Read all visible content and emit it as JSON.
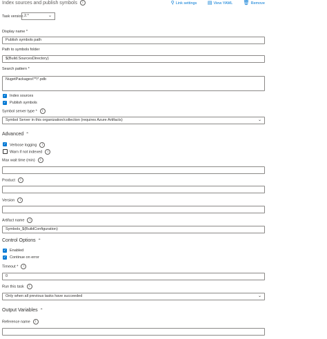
{
  "header": {
    "title": "Index sources and publish symbols",
    "link_settings": "Link settings",
    "view_yaml": "View YAML",
    "remove": "Remove"
  },
  "task_version": {
    "label": "Task version",
    "value": "2.*"
  },
  "fields": {
    "display_name": {
      "label": "Display name *",
      "value": "Publish symbols path"
    },
    "symbols_folder": {
      "label": "Path to symbols folder",
      "value": "$(Build.SourcesDirectory)"
    },
    "search_pattern": {
      "label": "Search pattern *",
      "value": "NugetPackages\\**\\*.pdb"
    },
    "symbol_server_type": {
      "label": "Symbol server type *",
      "value": "Symbol Server in this organization/collection (requires Azure Artifacts)"
    },
    "max_wait": {
      "label": "Max wait time (min)",
      "value": ""
    },
    "product": {
      "label": "Product",
      "value": ""
    },
    "version": {
      "label": "Version",
      "value": ""
    },
    "artifact_name": {
      "label": "Artifact name",
      "value": "Symbols_$(BuildConfiguration)"
    },
    "timeout": {
      "label": "Timeout *",
      "value": "0"
    },
    "run_this_task": {
      "label": "Run this task",
      "value": "Only when all previous tasks have succeeded"
    },
    "reference_name": {
      "label": "Reference name",
      "value": ""
    }
  },
  "checkboxes": {
    "index_sources": {
      "label": "Index sources",
      "checked": true
    },
    "publish_symbols": {
      "label": "Publish symbols",
      "checked": true
    },
    "verbose_logging": {
      "label": "Verbose logging",
      "checked": true
    },
    "warn_not_indexed": {
      "label": "Warn if not indexed",
      "checked": false
    },
    "enabled": {
      "label": "Enabled",
      "checked": true
    },
    "continue_on_error": {
      "label": "Continue on error",
      "checked": true
    }
  },
  "sections": {
    "advanced": "Advanced",
    "control_options": "Control Options",
    "output_variables": "Output Variables"
  },
  "colors": {
    "accent": "#0078d4",
    "text": "#323130",
    "border": "#8a8886"
  }
}
